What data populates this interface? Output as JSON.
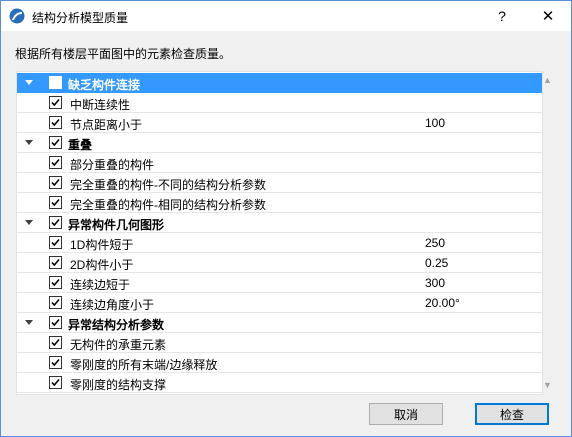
{
  "window": {
    "title": "结构分析模型质量",
    "help": "?",
    "close": "✕"
  },
  "instruction": "根据所有楼层平面图中的元素检查质量。",
  "groups": [
    {
      "label": "缺乏构件连接",
      "checked": true,
      "selected": true,
      "items": [
        {
          "label": "中断连续性",
          "value": "",
          "checked": true
        },
        {
          "label": "节点距离小于",
          "value": "100",
          "checked": true
        }
      ]
    },
    {
      "label": "重叠",
      "checked": true,
      "items": [
        {
          "label": "部分重叠的构件",
          "value": "",
          "checked": true
        },
        {
          "label": "完全重叠的构件-不同的结构分析参数",
          "value": "",
          "checked": true
        },
        {
          "label": "完全重叠的构件-相同的结构分析参数",
          "value": "",
          "checked": true
        }
      ]
    },
    {
      "label": "异常构件几何图形",
      "checked": true,
      "items": [
        {
          "label": "1D构件短于",
          "value": "250",
          "checked": true
        },
        {
          "label": "2D构件小于",
          "value": "0.25",
          "checked": true
        },
        {
          "label": "连续边短于",
          "value": "300",
          "checked": true
        },
        {
          "label": "连续边角度小于",
          "value": "20.00°",
          "checked": true
        }
      ]
    },
    {
      "label": "异常结构分析参数",
      "checked": true,
      "items": [
        {
          "label": "无构件的承重元素",
          "value": "",
          "checked": true
        },
        {
          "label": "零刚度的所有末端/边缘释放",
          "value": "",
          "checked": true
        },
        {
          "label": "零刚度的结构支撑",
          "value": "",
          "checked": true
        }
      ]
    }
  ],
  "buttons": {
    "cancel": "取消",
    "check": "检查"
  },
  "icons": {
    "app": "archicad-app-icon",
    "expander": "collapse-triangle-icon",
    "checkbox": "checkbox-checked-icon"
  },
  "colors": {
    "selection": "#3399ff",
    "window_border": "#5a8fd6",
    "default_button_border": "#0078d7"
  }
}
